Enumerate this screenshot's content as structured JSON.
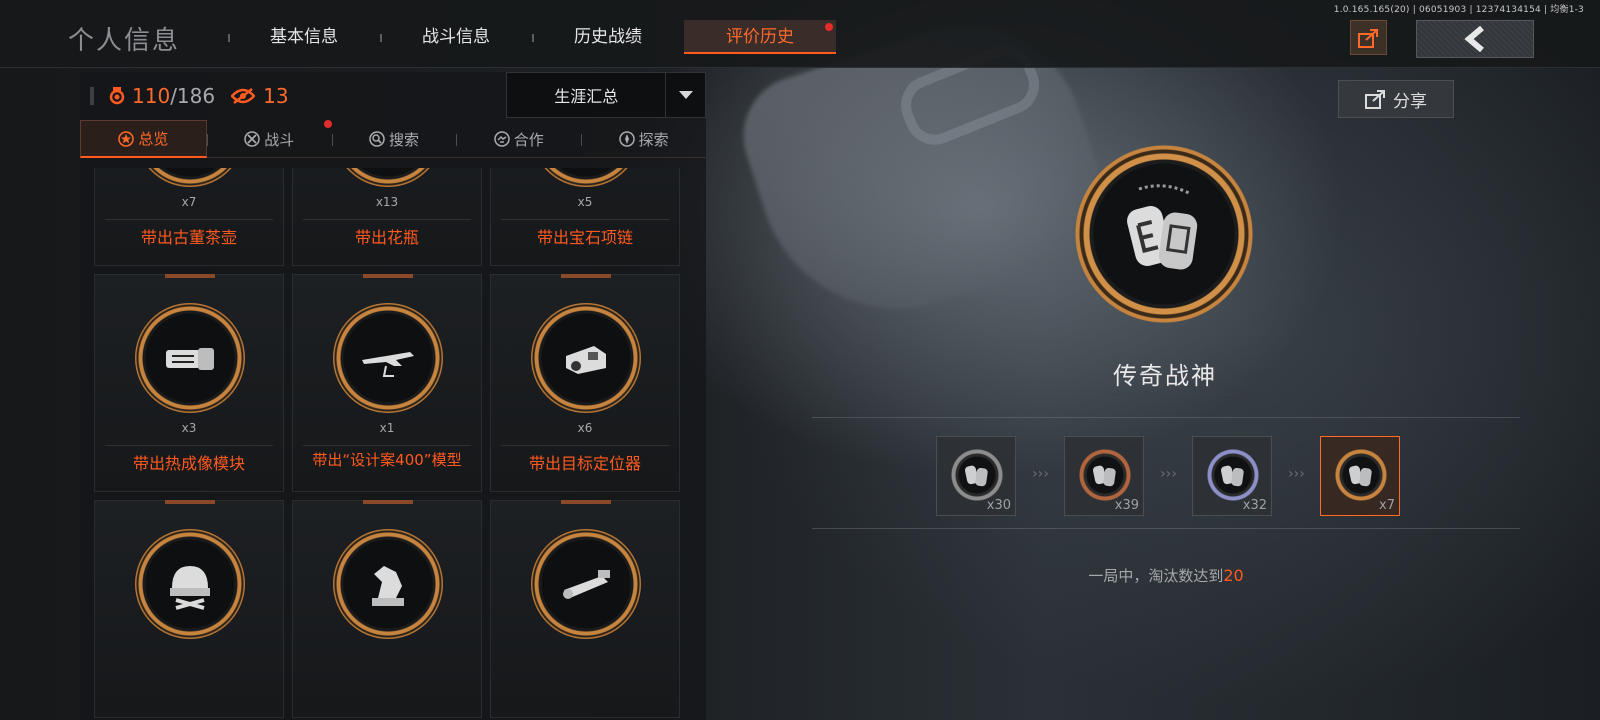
{
  "header": {
    "title": "个人信息",
    "tabs": [
      {
        "label": "基本信息",
        "active": false
      },
      {
        "label": "战斗信息",
        "active": false
      },
      {
        "label": "历史战绩",
        "active": false
      },
      {
        "label": "评价历史",
        "active": true,
        "notify": true
      }
    ],
    "version": "1.0.165.165(20) | 06051903 | 12374134154 | 均衡1-3"
  },
  "stats": {
    "owned": "110",
    "total": "/186",
    "viewed": "13",
    "owned_icon": "badge-icon",
    "viewed_icon": "eye-icon"
  },
  "filter": {
    "selected": "生涯汇总"
  },
  "sub_tabs": [
    {
      "label": "总览",
      "icon": "star-icon",
      "active": true
    },
    {
      "label": "战斗",
      "icon": "crossed-swords-icon",
      "notify": true
    },
    {
      "label": "搜索",
      "icon": "search-icon"
    },
    {
      "label": "合作",
      "icon": "handshake-icon"
    },
    {
      "label": "探索",
      "icon": "compass-icon"
    }
  ],
  "achievements": [
    {
      "name": "带出古董茶壶",
      "count": "x7",
      "icon": "teapot-icon"
    },
    {
      "name": "带出花瓶",
      "count": "x13",
      "icon": "vase-icon"
    },
    {
      "name": "带出宝石项链",
      "count": "x5",
      "icon": "necklace-icon"
    },
    {
      "name": "带出热成像模块",
      "count": "x3",
      "icon": "thermal-module-icon"
    },
    {
      "name": "带出“设计案400”模型",
      "count": "x1",
      "icon": "plane-model-icon"
    },
    {
      "name": "带出目标定位器",
      "count": "x6",
      "icon": "locator-icon"
    },
    {
      "name": "",
      "count": "",
      "icon": "helmet-icon"
    },
    {
      "name": "",
      "count": "",
      "icon": "horse-statue-icon"
    },
    {
      "name": "",
      "count": "",
      "icon": "scope-icon"
    }
  ],
  "detail": {
    "title": "传奇战神",
    "icon": "dog-tags-icon",
    "tiers": [
      {
        "count": "x30",
        "tier": "silver"
      },
      {
        "count": "x39",
        "tier": "bronze"
      },
      {
        "count": "x32",
        "tier": "purple"
      },
      {
        "count": "x7",
        "tier": "gold",
        "active": true
      }
    ],
    "description_prefix": "一局中，淘汰数达到",
    "description_value": "20",
    "share_label": "分享"
  },
  "colors": {
    "accent": "#ff5a1f",
    "gold": "#c7843e",
    "notify": "#e52c2c"
  }
}
